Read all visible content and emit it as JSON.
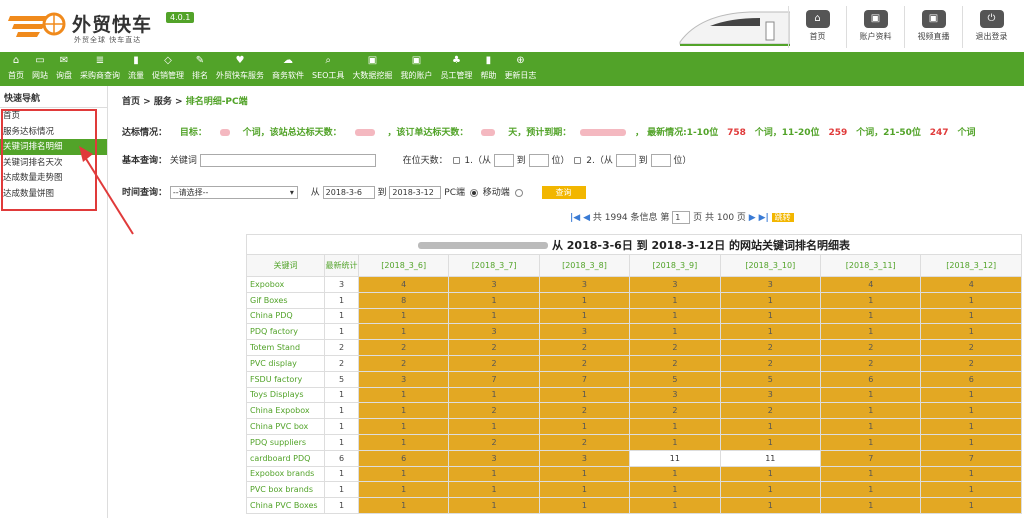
{
  "header": {
    "logo_text": "外贸快车",
    "version": "4.0.1",
    "tagline": "外贸全球 快车直达",
    "buttons": [
      {
        "label": "首页",
        "icon": "home-icon"
      },
      {
        "label": "账户资料",
        "icon": "briefcase-icon"
      },
      {
        "label": "视频直播",
        "icon": "briefcase-icon"
      },
      {
        "label": "退出登录",
        "icon": "power-icon"
      }
    ]
  },
  "nav": [
    {
      "label": "首页",
      "icon": "⌂"
    },
    {
      "label": "网站",
      "icon": "▭"
    },
    {
      "label": "询盘",
      "icon": "✉"
    },
    {
      "label": "采购商查询",
      "icon": "≣"
    },
    {
      "label": "流量",
      "icon": "▮"
    },
    {
      "label": "促销管理",
      "icon": "◇"
    },
    {
      "label": "排名",
      "icon": "✎"
    },
    {
      "label": "外贸快车服务",
      "icon": "♥"
    },
    {
      "label": "商务软件",
      "icon": "☁"
    },
    {
      "label": "SEO工具",
      "icon": "⌕"
    },
    {
      "label": "大数据挖掘",
      "icon": "▣"
    },
    {
      "label": "我的账户",
      "icon": "▣"
    },
    {
      "label": "员工管理",
      "icon": "♣"
    },
    {
      "label": "帮助",
      "icon": "▮"
    },
    {
      "label": "更新日志",
      "icon": "⊕"
    }
  ],
  "sidebar": {
    "title": "快速导航",
    "items": [
      {
        "label": "首页",
        "active": false
      },
      {
        "label": "服务达标情况",
        "active": false
      },
      {
        "label": "关键词排名明细",
        "active": true
      },
      {
        "label": "关键词排名天次",
        "active": false
      },
      {
        "label": "达成数量走势图",
        "active": false
      },
      {
        "label": "达成数量饼图",
        "active": false
      }
    ]
  },
  "breadcrumb": {
    "home": "首页",
    "sep": ">",
    "service": "服务",
    "current": "排名明细-PC端"
  },
  "status": {
    "label": "达标情况：",
    "target_label": "目标：",
    "target_unit": "个词，该站总达标天数：",
    "reached_label": "，该订单达标天数：",
    "reached_unit": "天，预计到期：",
    "latest_label": "， 最新情况:1-10位",
    "top10": "758",
    "unit1": "个词，11-20位",
    "top20": "259",
    "unit2": "个词，21-50位",
    "top50": "247",
    "unit3": "个词"
  },
  "basic_query": {
    "label": "基本查询：",
    "kw_label": "关键词",
    "kw_value": "",
    "days_label": "在位天数：",
    "opt1": "1.（从",
    "to": "到",
    "pos": "位）",
    "opt2": "2.（从",
    "pos2": "位）"
  },
  "time_query": {
    "label": "时间查询：",
    "select_value": "--请选择--",
    "from": "从",
    "start": "2018-3-6",
    "to": "到",
    "end": "2018-3-12",
    "pc": "PC端",
    "mobile": "移动端",
    "query_btn": "查询"
  },
  "pager": {
    "text": "共 1994 条信息 第",
    "page": "1",
    "total": "页 共 100 页",
    "go": "跳转"
  },
  "table": {
    "caption": "从 2018-3-6日 到 2018-3-12日 的网站关键词排名明细表",
    "headers": [
      "关键词",
      "最新统计",
      "[2018_3_6]",
      "[2018_3_7]",
      "[2018_3_8]",
      "[2018_3_9]",
      "[2018_3_10]",
      "[2018_3_11]",
      "[2018_3_12]"
    ],
    "rows": [
      {
        "kw": "Expobox",
        "latest": "3",
        "days": [
          "4",
          "3",
          "3",
          "3",
          "3",
          "4",
          "4"
        ]
      },
      {
        "kw": "Gif Boxes",
        "latest": "1",
        "days": [
          "8",
          "1",
          "1",
          "1",
          "1",
          "1",
          "1"
        ]
      },
      {
        "kw": "China PDQ",
        "latest": "1",
        "days": [
          "1",
          "1",
          "1",
          "1",
          "1",
          "1",
          "1"
        ]
      },
      {
        "kw": "PDQ factory",
        "latest": "1",
        "days": [
          "1",
          "3",
          "3",
          "1",
          "1",
          "1",
          "1"
        ]
      },
      {
        "kw": "Totem Stand",
        "latest": "2",
        "days": [
          "2",
          "2",
          "2",
          "2",
          "2",
          "2",
          "2"
        ]
      },
      {
        "kw": "PVC display",
        "latest": "2",
        "days": [
          "2",
          "2",
          "2",
          "2",
          "2",
          "2",
          "2"
        ]
      },
      {
        "kw": "FSDU factory",
        "latest": "5",
        "days": [
          "3",
          "7",
          "7",
          "5",
          "5",
          "6",
          "6"
        ]
      },
      {
        "kw": "Toys Displays",
        "latest": "1",
        "days": [
          "1",
          "1",
          "1",
          "3",
          "3",
          "1",
          "1"
        ]
      },
      {
        "kw": "China Expobox",
        "latest": "1",
        "days": [
          "1",
          "2",
          "2",
          "2",
          "2",
          "1",
          "1"
        ]
      },
      {
        "kw": "China PVC box",
        "latest": "1",
        "days": [
          "1",
          "1",
          "1",
          "1",
          "1",
          "1",
          "1"
        ]
      },
      {
        "kw": "PDQ suppliers",
        "latest": "1",
        "days": [
          "1",
          "2",
          "2",
          "1",
          "1",
          "1",
          "1"
        ]
      },
      {
        "kw": "cardboard PDQ",
        "latest": "6",
        "days": [
          "6",
          "3",
          "3",
          "11",
          "11",
          "7",
          "7"
        ]
      },
      {
        "kw": "Expobox brands",
        "latest": "1",
        "days": [
          "1",
          "1",
          "1",
          "1",
          "1",
          "1",
          "1"
        ]
      },
      {
        "kw": "PVC box brands",
        "latest": "1",
        "days": [
          "1",
          "1",
          "1",
          "1",
          "1",
          "1",
          "1"
        ]
      },
      {
        "kw": "China PVC Boxes",
        "latest": "1",
        "days": [
          "1",
          "1",
          "1",
          "1",
          "1",
          "1",
          "1"
        ]
      }
    ]
  },
  "colors": {
    "brand_green": "#52a329",
    "cell_gold": "#e3a823",
    "highlight_red": "#e03a3a"
  }
}
